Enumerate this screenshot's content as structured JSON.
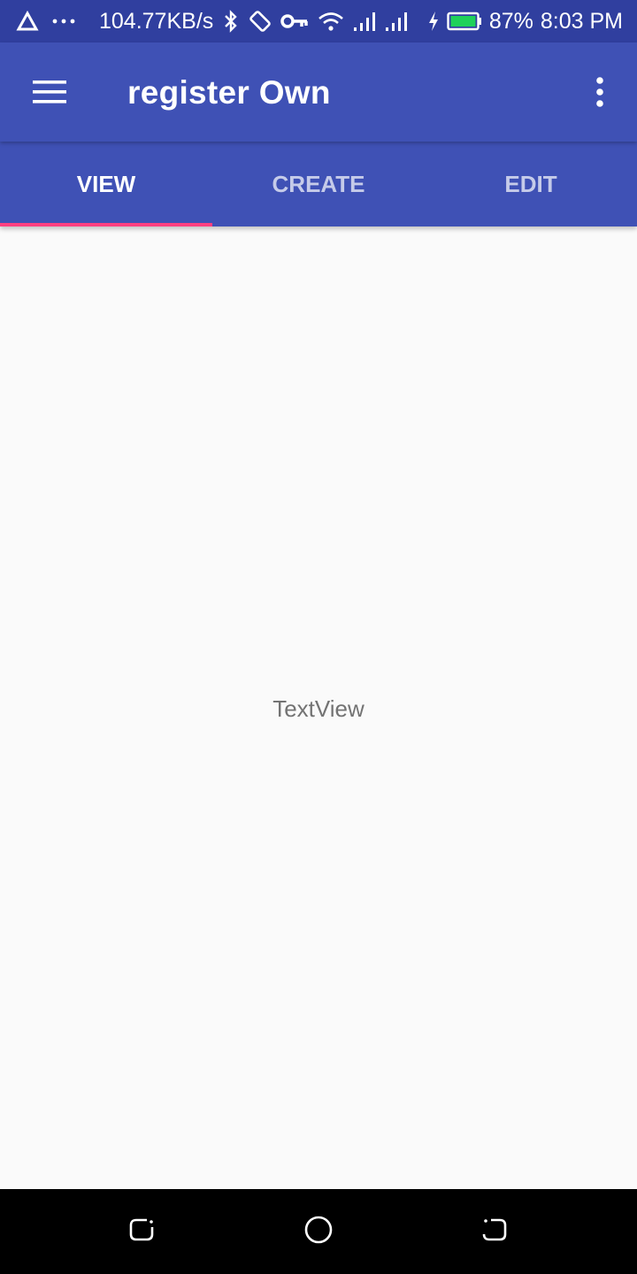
{
  "status_bar": {
    "speed": "104.77KB/s",
    "battery_percent": "87%",
    "time": "8:03 PM",
    "icons": [
      "alert-triangle-icon",
      "more-dots-icon",
      "bluetooth-icon",
      "rotate-icon",
      "vpn-key-icon",
      "wifi-icon",
      "signal-icon",
      "signal-icon",
      "charging-icon",
      "battery-icon"
    ]
  },
  "app_bar": {
    "title": "register Own",
    "menu_icon": "hamburger-menu-icon",
    "overflow_icon": "more-vert-icon"
  },
  "tabs": [
    {
      "label": "VIEW",
      "active": true
    },
    {
      "label": "CREATE",
      "active": false
    },
    {
      "label": "EDIT",
      "active": false
    }
  ],
  "content": {
    "text": "TextView"
  },
  "nav_bar": {
    "buttons": [
      "recent-apps-icon",
      "home-icon",
      "back-icon"
    ]
  },
  "colors": {
    "status_bar": "#303f9f",
    "primary": "#3f51b5",
    "accent": "#ff4081",
    "background": "#fafafa",
    "battery_fill": "#1fd15a"
  }
}
